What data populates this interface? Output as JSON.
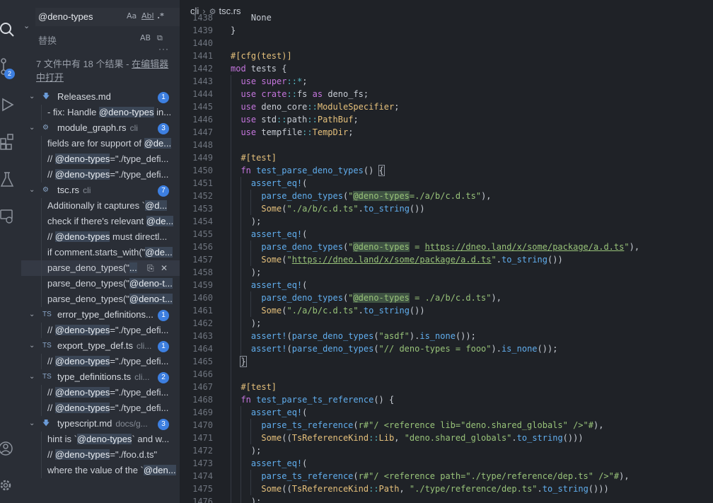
{
  "search": {
    "query": "@deno-types",
    "opt_case": "Aa",
    "opt_word": "Abl",
    "opt_regex": ".*",
    "replace_placeholder": "替换",
    "opt_preserve_case": "AB",
    "summary_text": "7 文件中有 18 个结果 - ",
    "summary_link": "在编辑器中打开"
  },
  "activity": {
    "scm_badge": "2"
  },
  "results": [
    {
      "type": "file",
      "icon": "markdown",
      "name": "Releases.md",
      "dir": "",
      "count": "1"
    },
    {
      "type": "match",
      "pre": "- fix: Handle ",
      "hl": "@deno-types",
      "post": " in..."
    },
    {
      "type": "file",
      "icon": "rust",
      "name": "module_graph.rs",
      "dir": "cli",
      "count": "3"
    },
    {
      "type": "match",
      "pre": "fields are for support of ",
      "hl": "@de...",
      "post": ""
    },
    {
      "type": "match",
      "pre": "// ",
      "hl": "@deno-types",
      "post": "=\"./type_defi..."
    },
    {
      "type": "match",
      "pre": "// ",
      "hl": "@deno-types",
      "post": "=\"./type_defi..."
    },
    {
      "type": "file",
      "icon": "rust",
      "name": "tsc.rs",
      "dir": "cli",
      "count": "7"
    },
    {
      "type": "match",
      "pre": "Additionally it captures `",
      "hl": "@d...",
      "post": ""
    },
    {
      "type": "match",
      "pre": "check if there's relevant ",
      "hl": "@de...",
      "post": ""
    },
    {
      "type": "match",
      "pre": "// ",
      "hl": "@deno-types",
      "post": " must directl..."
    },
    {
      "type": "match",
      "pre": "if comment.starts_with(\"",
      "hl": "@de...",
      "post": ""
    },
    {
      "type": "match",
      "pre": "parse_deno_types(\"",
      "hl": "...",
      "post": "",
      "active": true
    },
    {
      "type": "match",
      "pre": "parse_deno_types(\"",
      "hl": "@deno-t...",
      "post": ""
    },
    {
      "type": "match",
      "pre": "parse_deno_types(\"",
      "hl": "@deno-t...",
      "post": ""
    },
    {
      "type": "file",
      "icon": "ts",
      "name": "error_type_definitions...",
      "dir": "",
      "count": "1"
    },
    {
      "type": "match",
      "pre": "// ",
      "hl": "@deno-types",
      "post": "=\"./type_defi..."
    },
    {
      "type": "file",
      "icon": "ts",
      "name": "export_type_def.ts",
      "dir": "cli...",
      "count": "1"
    },
    {
      "type": "match",
      "pre": "// ",
      "hl": "@deno-types",
      "post": "=\"./type_defi..."
    },
    {
      "type": "file",
      "icon": "ts",
      "name": "type_definitions.ts",
      "dir": "cli...",
      "count": "2"
    },
    {
      "type": "match",
      "pre": "// ",
      "hl": "@deno-types",
      "post": "=\"./type_defi..."
    },
    {
      "type": "match",
      "pre": "// ",
      "hl": "@deno-types",
      "post": "=\"./type_defi..."
    },
    {
      "type": "file",
      "icon": "markdown",
      "name": "typescript.md",
      "dir": "docs/g...",
      "count": "3"
    },
    {
      "type": "match",
      "pre": "hint is `",
      "hl": "@deno-types",
      "post": "` and w..."
    },
    {
      "type": "match",
      "pre": "// ",
      "hl": "@deno-types",
      "post": "=\"./foo.d.ts\""
    },
    {
      "type": "match",
      "pre": "where the value of the `",
      "hl": "@den...",
      "post": ""
    }
  ],
  "editor": {
    "breadcrumb": [
      "cli",
      "tsc.rs"
    ],
    "lines": [
      {
        "n": "1438",
        "t": "    None"
      },
      {
        "n": "1439",
        "t": "}"
      },
      {
        "n": "1440",
        "t": ""
      },
      {
        "n": "1441",
        "t": "#[cfg(test)]"
      },
      {
        "n": "1442",
        "t": "mod tests {"
      },
      {
        "n": "1443",
        "t": "  use super::*;"
      },
      {
        "n": "1444",
        "t": "  use crate::fs as deno_fs;"
      },
      {
        "n": "1445",
        "t": "  use deno_core::ModuleSpecifier;"
      },
      {
        "n": "1446",
        "t": "  use std::path::PathBuf;"
      },
      {
        "n": "1447",
        "t": "  use tempfile::TempDir;"
      },
      {
        "n": "1448",
        "t": ""
      },
      {
        "n": "1449",
        "t": "  #[test]"
      },
      {
        "n": "1450",
        "t": "  fn test_parse_deno_types() {"
      },
      {
        "n": "1451",
        "t": "    assert_eq!("
      },
      {
        "n": "1452",
        "t": "      parse_deno_types(\"@deno-types=./a/b/c.d.ts\"),"
      },
      {
        "n": "1453",
        "t": "      Some(\"./a/b/c.d.ts\".to_string())"
      },
      {
        "n": "1454",
        "t": "    );"
      },
      {
        "n": "1455",
        "t": "    assert_eq!("
      },
      {
        "n": "1456",
        "t": "      parse_deno_types(\"@deno-types = https://dneo.land/x/some/package/a.d.ts\"),"
      },
      {
        "n": "1457",
        "t": "      Some(\"https://dneo.land/x/some/package/a.d.ts\".to_string())"
      },
      {
        "n": "1458",
        "t": "    );"
      },
      {
        "n": "1459",
        "t": "    assert_eq!("
      },
      {
        "n": "1460",
        "t": "      parse_deno_types(\"@deno-types = ./a/b/c.d.ts\"),"
      },
      {
        "n": "1461",
        "t": "      Some(\"./a/b/c.d.ts\".to_string())"
      },
      {
        "n": "1462",
        "t": "    );"
      },
      {
        "n": "1463",
        "t": "    assert!(parse_deno_types(\"asdf\").is_none());"
      },
      {
        "n": "1464",
        "t": "    assert!(parse_deno_types(\"// deno-types = fooo\").is_none());"
      },
      {
        "n": "1465",
        "t": "  }"
      },
      {
        "n": "1466",
        "t": ""
      },
      {
        "n": "1467",
        "t": "  #[test]"
      },
      {
        "n": "1468",
        "t": "  fn test_parse_ts_reference() {"
      },
      {
        "n": "1469",
        "t": "    assert_eq!("
      },
      {
        "n": "1470",
        "t": "      parse_ts_reference(r#\"/ <reference lib=\"deno.shared_globals\" />\"#),"
      },
      {
        "n": "1471",
        "t": "      Some((TsReferenceKind::Lib, \"deno.shared_globals\".to_string()))"
      },
      {
        "n": "1472",
        "t": "    );"
      },
      {
        "n": "1473",
        "t": "    assert_eq!("
      },
      {
        "n": "1474",
        "t": "      parse_ts_reference(r#\"/ <reference path=\"./type/reference/dep.ts\" />\"#),"
      },
      {
        "n": "1475",
        "t": "      Some((TsReferenceKind::Path, \"./type/reference/dep.ts\".to_string()))"
      },
      {
        "n": "1476",
        "t": "    );"
      }
    ]
  },
  "colors": {
    "accent": "#3d7fe0",
    "keyword": "#c475dd",
    "function": "#61aeee",
    "string": "#98c379",
    "type": "#e5c07b"
  }
}
